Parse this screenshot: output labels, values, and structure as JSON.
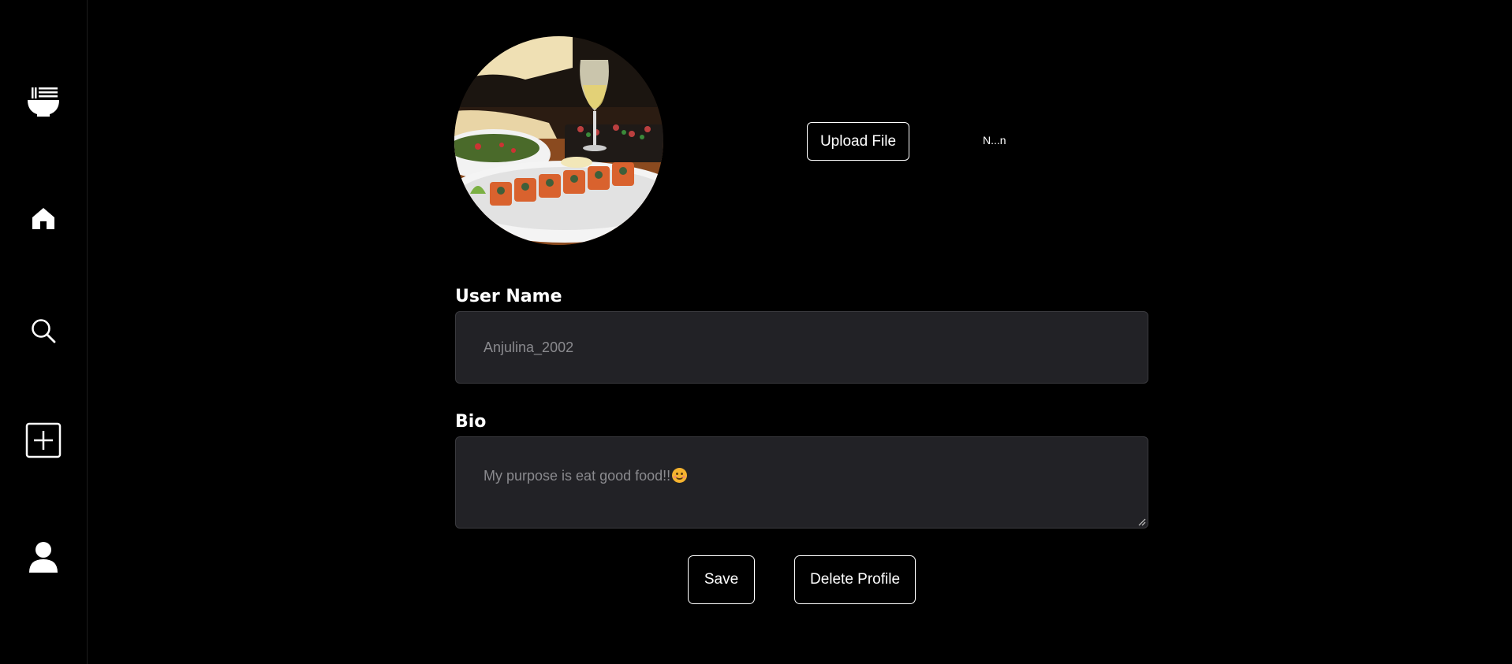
{
  "sidebar": {
    "items": [
      {
        "icon": "ramen-bowl-logo-icon"
      },
      {
        "icon": "home-icon"
      },
      {
        "icon": "search-icon"
      },
      {
        "icon": "add-post-icon"
      },
      {
        "icon": "profile-icon"
      }
    ]
  },
  "profile": {
    "avatar_description_icon": "profile-photo-sushi",
    "upload_label": "Upload File",
    "file_name": "N...n"
  },
  "form": {
    "username_label": "User Name",
    "username_value": "Anjulina_2002",
    "bio_label": "Bio",
    "bio_value": "My purpose is eat good food!!",
    "bio_emoji": "smiling-face-emoji"
  },
  "actions": {
    "save_label": "Save",
    "delete_label": "Delete Profile"
  },
  "colors": {
    "background": "#000000",
    "field_background": "#222226",
    "text": "#ffffff",
    "field_text": "#8a8a8e"
  }
}
